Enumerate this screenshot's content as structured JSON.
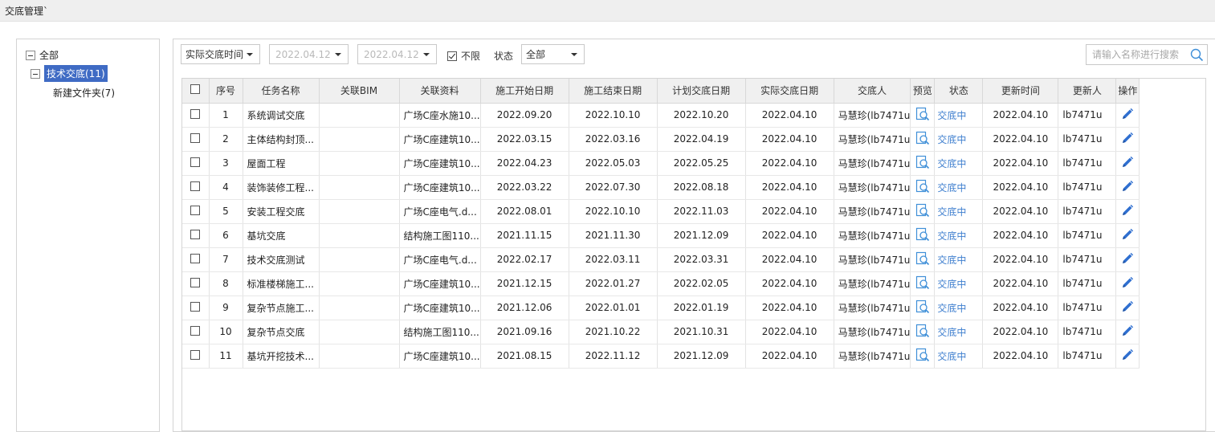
{
  "app": {
    "title": "交底管理`"
  },
  "sidebar": {
    "root": {
      "label": "全部"
    },
    "group": {
      "label": "技术交底(11)"
    },
    "folder": {
      "label": "新建文件夹(7)"
    }
  },
  "toolbar": {
    "date_type": "实际交底时间",
    "start_date": "2022.04.12",
    "end_date": "2022.04.12",
    "unlimited_label": "不限",
    "unlimited_checked": true,
    "status_label": "状态",
    "status_value": "全部",
    "search_placeholder": "请输入名称进行搜索"
  },
  "table": {
    "headers": {
      "index": "序号",
      "task_name": "任务名称",
      "bim": "关联BIM",
      "files": "关联资料",
      "start": "施工开始日期",
      "end": "施工结束日期",
      "planned": "计划交底日期",
      "actual": "实际交底日期",
      "person": "交底人",
      "preview": "预览",
      "status": "状态",
      "updated": "更新时间",
      "updater": "更新人",
      "ops": "操作"
    },
    "rows": [
      {
        "index": "1",
        "name": "系统调试交底",
        "bim": "",
        "files": "广场C座水施10...",
        "start": "2022.09.20",
        "end": "2022.10.10",
        "planned": "2022.10.20",
        "actual": "2022.04.10",
        "person": "马慧珍(lb7471u",
        "status": "交底中",
        "updated": "2022.04.10",
        "updater": "lb7471u"
      },
      {
        "index": "2",
        "name": "主体结构封顶...",
        "bim": "",
        "files": "广场C座建筑10...",
        "start": "2022.03.15",
        "end": "2022.03.16",
        "planned": "2022.04.19",
        "actual": "2022.04.10",
        "person": "马慧珍(lb7471u",
        "status": "交底中",
        "updated": "2022.04.10",
        "updater": "lb7471u"
      },
      {
        "index": "3",
        "name": "屋面工程",
        "bim": "",
        "files": "广场C座建筑10...",
        "start": "2022.04.23",
        "end": "2022.05.03",
        "planned": "2022.05.25",
        "actual": "2022.04.10",
        "person": "马慧珍(lb7471u",
        "status": "交底中",
        "updated": "2022.04.10",
        "updater": "lb7471u"
      },
      {
        "index": "4",
        "name": "装饰装修工程...",
        "bim": "",
        "files": "广场C座建筑10...",
        "start": "2022.03.22",
        "end": "2022.07.30",
        "planned": "2022.08.18",
        "actual": "2022.04.10",
        "person": "马慧珍(lb7471u",
        "status": "交底中",
        "updated": "2022.04.10",
        "updater": "lb7471u"
      },
      {
        "index": "5",
        "name": "安装工程交底",
        "bim": "",
        "files": "广场C座电气.d...",
        "start": "2022.08.01",
        "end": "2022.10.10",
        "planned": "2022.11.03",
        "actual": "2022.04.10",
        "person": "马慧珍(lb7471u",
        "status": "交底中",
        "updated": "2022.04.10",
        "updater": "lb7471u"
      },
      {
        "index": "6",
        "name": "基坑交底",
        "bim": "",
        "files": "结构施工图110...",
        "start": "2021.11.15",
        "end": "2021.11.30",
        "planned": "2021.12.09",
        "actual": "2022.04.10",
        "person": "马慧珍(lb7471u",
        "status": "交底中",
        "updated": "2022.04.10",
        "updater": "lb7471u"
      },
      {
        "index": "7",
        "name": "技术交底测试",
        "bim": "",
        "files": "广场C座电气.d...",
        "start": "2022.02.17",
        "end": "2022.03.11",
        "planned": "2022.03.31",
        "actual": "2022.04.10",
        "person": "马慧珍(lb7471u",
        "status": "交底中",
        "updated": "2022.04.10",
        "updater": "lb7471u"
      },
      {
        "index": "8",
        "name": "标准楼梯施工...",
        "bim": "",
        "files": "广场C座建筑10...",
        "start": "2021.12.15",
        "end": "2022.01.27",
        "planned": "2022.02.05",
        "actual": "2022.04.10",
        "person": "马慧珍(lb7471u",
        "status": "交底中",
        "updated": "2022.04.10",
        "updater": "lb7471u"
      },
      {
        "index": "9",
        "name": "复杂节点施工...",
        "bim": "",
        "files": "广场C座建筑10...",
        "start": "2021.12.06",
        "end": "2022.01.01",
        "planned": "2022.01.19",
        "actual": "2022.04.10",
        "person": "马慧珍(lb7471u",
        "status": "交底中",
        "updated": "2022.04.10",
        "updater": "lb7471u"
      },
      {
        "index": "10",
        "name": "复杂节点交底",
        "bim": "",
        "files": "结构施工图110...",
        "start": "2021.09.16",
        "end": "2021.10.22",
        "planned": "2021.10.31",
        "actual": "2022.04.10",
        "person": "马慧珍(lb7471u",
        "status": "交底中",
        "updated": "2022.04.10",
        "updater": "lb7471u"
      },
      {
        "index": "11",
        "name": "基坑开挖技术...",
        "bim": "",
        "files": "广场C座建筑10...",
        "start": "2021.08.15",
        "end": "2022.11.12",
        "planned": "2021.12.09",
        "actual": "2022.04.10",
        "person": "马慧珍(lb7471u",
        "status": "交底中",
        "updated": "2022.04.10",
        "updater": "lb7471u"
      }
    ]
  },
  "colors": {
    "accent": "#3f6bc4",
    "status": "#3f7fcf",
    "edit_icon": "#2f6fd0"
  },
  "icons": {
    "search": "magnifier-icon",
    "preview": "preview-magnifier-icon",
    "edit": "pencil-icon"
  }
}
